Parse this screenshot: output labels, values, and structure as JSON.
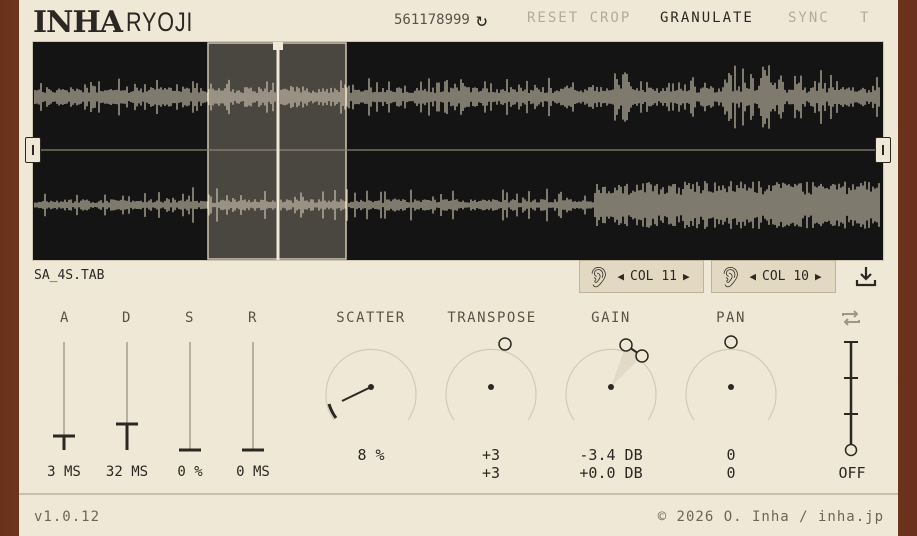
{
  "brand": {
    "mark": "INHA",
    "name": "RYOJI"
  },
  "header": {
    "seed": "561178999",
    "reset_crop": "RESET CROP",
    "granulate": "GRANULATE",
    "sync": "SYNC",
    "t": "T"
  },
  "file": {
    "name": "SA_4S.TAB"
  },
  "columns": {
    "left_label": "COL 11",
    "right_label": "COL 10"
  },
  "envelope": {
    "a": {
      "label": "A",
      "value": "3 MS"
    },
    "d": {
      "label": "D",
      "value": "32 MS"
    },
    "s": {
      "label": "S",
      "value": "0 %"
    },
    "r": {
      "label": "R",
      "value": "0 MS"
    }
  },
  "knobs": {
    "scatter": {
      "label": "SCATTER",
      "value": "8 %"
    },
    "transpose": {
      "label": "TRANSPOSE",
      "value1": "+3",
      "value2": "+3"
    },
    "gain": {
      "label": "GAIN",
      "value1": "-3.4 DB",
      "value2": "+0.0 DB"
    },
    "pan": {
      "label": "PAN",
      "value1": "0",
      "value2": "0"
    }
  },
  "loop": {
    "value": "OFF"
  },
  "footer": {
    "version": "v1.0.12",
    "copyright": "© 2026 O. Inha / inha.jp"
  },
  "colors": {
    "accent": "#2b2722",
    "panel": "#f0e8d6",
    "wave": "#e8dfc8",
    "bg": "#141414"
  }
}
